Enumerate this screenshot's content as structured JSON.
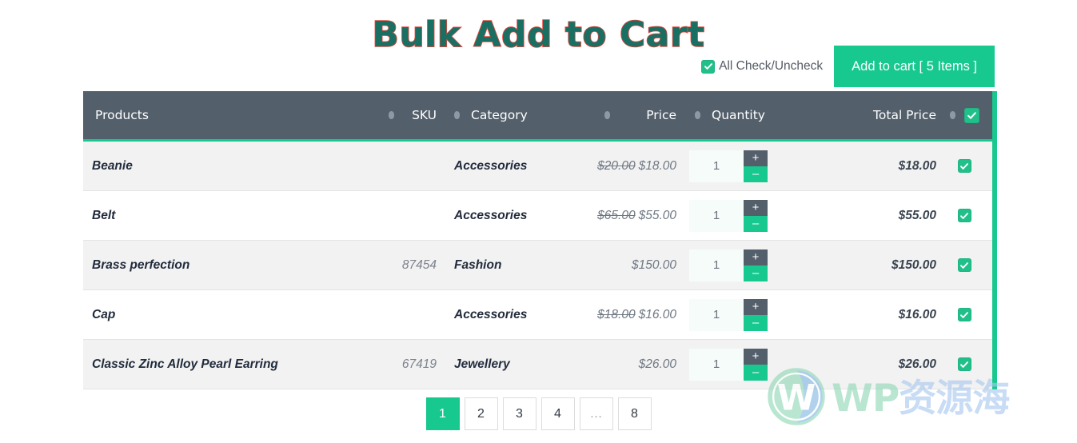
{
  "page": {
    "title": "Bulk Add to Cart",
    "title_fill_color": "#1a6f63",
    "title_stroke_color": "#e8453c"
  },
  "toolbar": {
    "all_check_label": "All Check/Uncheck",
    "all_check_checked": true,
    "add_to_cart_label": "Add to cart [ 5 Items ]",
    "accent_color": "#17c88f"
  },
  "table": {
    "header_bg": "#535f6b",
    "columns": [
      {
        "label": "Products",
        "sortable": true,
        "align": "left"
      },
      {
        "label": "SKU",
        "sortable": true,
        "align": "right"
      },
      {
        "label": "Category",
        "sortable": true,
        "align": "left"
      },
      {
        "label": "Price",
        "sortable": true,
        "align": "right"
      },
      {
        "label": "Quantity",
        "sortable": false,
        "align": "left"
      },
      {
        "label": "Total Price",
        "sortable": true,
        "align": "right"
      },
      {
        "label": "",
        "sortable": false,
        "align": "center"
      }
    ],
    "header_select_all_checked": true,
    "rows": [
      {
        "product": "Beanie",
        "sku": "",
        "category": "Accessories",
        "price_old": "$20.00",
        "price_new": "$18.00",
        "quantity": "1",
        "total": "$18.00",
        "selected": true
      },
      {
        "product": "Belt",
        "sku": "",
        "category": "Accessories",
        "price_old": "$65.00",
        "price_new": "$55.00",
        "quantity": "1",
        "total": "$55.00",
        "selected": true
      },
      {
        "product": "Brass perfection",
        "sku": "87454",
        "category": "Fashion",
        "price_old": "",
        "price_new": "$150.00",
        "quantity": "1",
        "total": "$150.00",
        "selected": true
      },
      {
        "product": "Cap",
        "sku": "",
        "category": "Accessories",
        "price_old": "$18.00",
        "price_new": "$16.00",
        "quantity": "1",
        "total": "$16.00",
        "selected": true
      },
      {
        "product": "Classic Zinc Alloy Pearl Earring",
        "sku": "67419",
        "category": "Jewellery",
        "price_old": "",
        "price_new": "$26.00",
        "quantity": "1",
        "total": "$26.00",
        "selected": true
      }
    ],
    "stepper": {
      "increment_label": "+",
      "decrement_label": "–"
    }
  },
  "pagination": {
    "pages": [
      "1",
      "2",
      "3",
      "4",
      "…",
      "8"
    ],
    "active_index": 0
  },
  "watermark": {
    "text_en": "WP",
    "text_cn": "资源海",
    "logo": "wordpress-logo"
  }
}
